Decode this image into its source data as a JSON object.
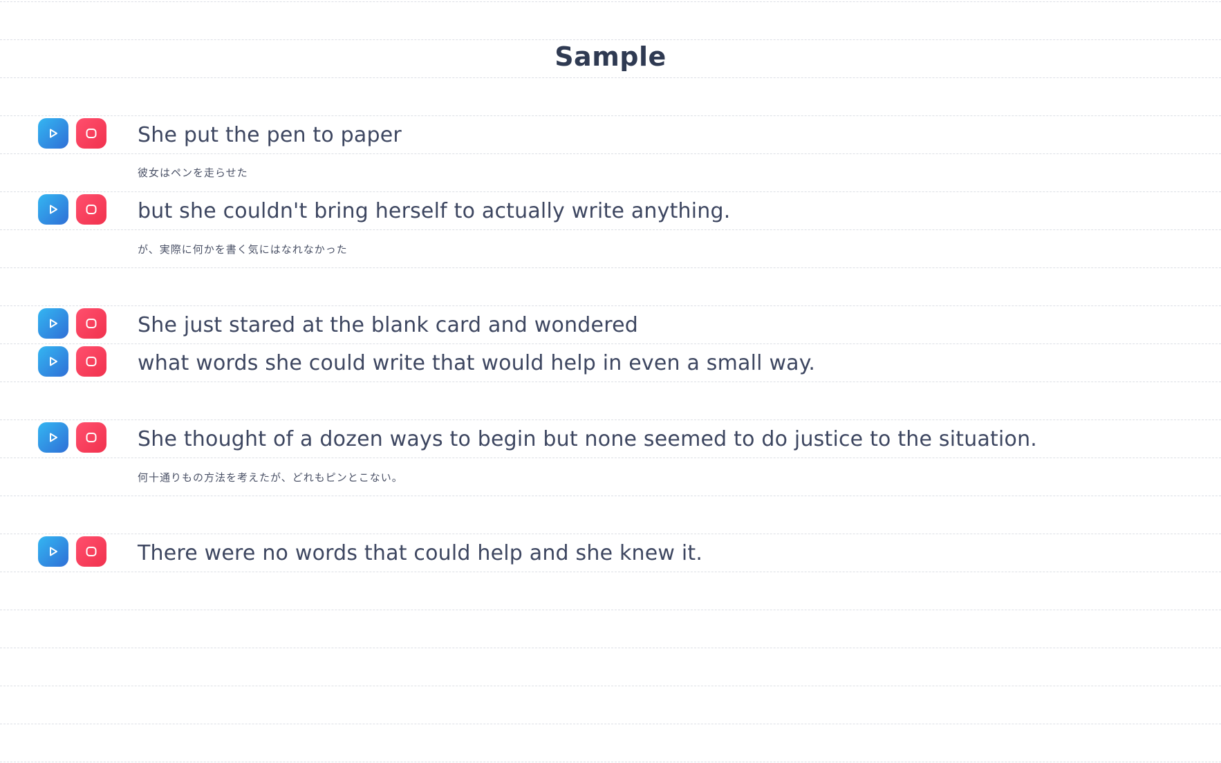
{
  "title": "Sample",
  "sentences": [
    {
      "text": "She put the pen to paper",
      "translation": "彼女はペンを走らせた"
    },
    {
      "text": "but she couldn't bring herself to actually write anything.",
      "translation": "が、実際に何かを書く気にはなれなかった"
    },
    {
      "text": "She just stared at the blank card and wondered",
      "translation": ""
    },
    {
      "text": "what words she could write that would help in even a small way.",
      "translation": ""
    },
    {
      "text": "She thought of a dozen ways to begin but none seemed to do justice to the situation.",
      "translation": "何十通りもの方法を考えたが、どれもピンとこない。"
    },
    {
      "text": "There were no words that could help and she knew it.",
      "translation": ""
    }
  ],
  "icons": {
    "play": "play-icon",
    "record": "record-icon"
  },
  "colors": {
    "play_gradient": [
      "#34b6f2",
      "#2f6fd6"
    ],
    "record_gradient": [
      "#ff4f6d",
      "#f1324e"
    ],
    "text": "#3d4660",
    "ruled_line": "#dcdfe5"
  }
}
